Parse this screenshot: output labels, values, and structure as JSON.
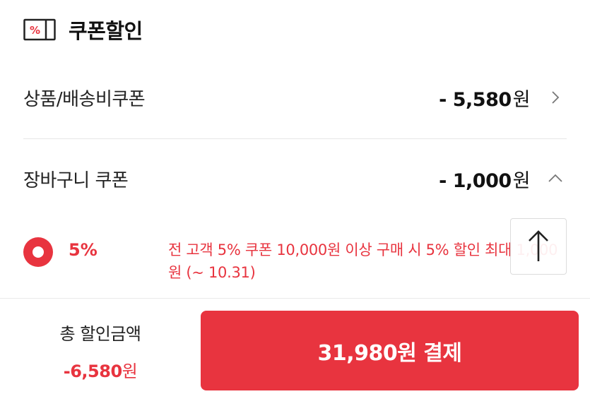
{
  "header": {
    "title": "쿠폰할인",
    "icon": "percent-coupon-icon",
    "icon_text": "%"
  },
  "rows": [
    {
      "label": "상품/배송비쿠폰",
      "amount": "- 5,580",
      "unit": "원",
      "chevron": "chevron-right-icon"
    },
    {
      "label": "장바구니 쿠폰",
      "amount": "- 1,000",
      "unit": "원",
      "chevron": "chevron-up-icon"
    }
  ],
  "coupon_option": {
    "selected": true,
    "rate": "5%",
    "description": "전 고객 5% 쿠폰 10,000원 이상 구매 시 5% 할인 최대 1,000원 (~ 10.31)"
  },
  "scroll_top": {
    "icon": "arrow-up-icon"
  },
  "footer": {
    "total_label": "총 할인금액",
    "total_amount": "-6,580",
    "total_unit": "원",
    "pay_label": "31,980원 결제"
  },
  "colors": {
    "accent": "#e8343f",
    "divider": "#e6e6e6",
    "text": "#111111"
  }
}
